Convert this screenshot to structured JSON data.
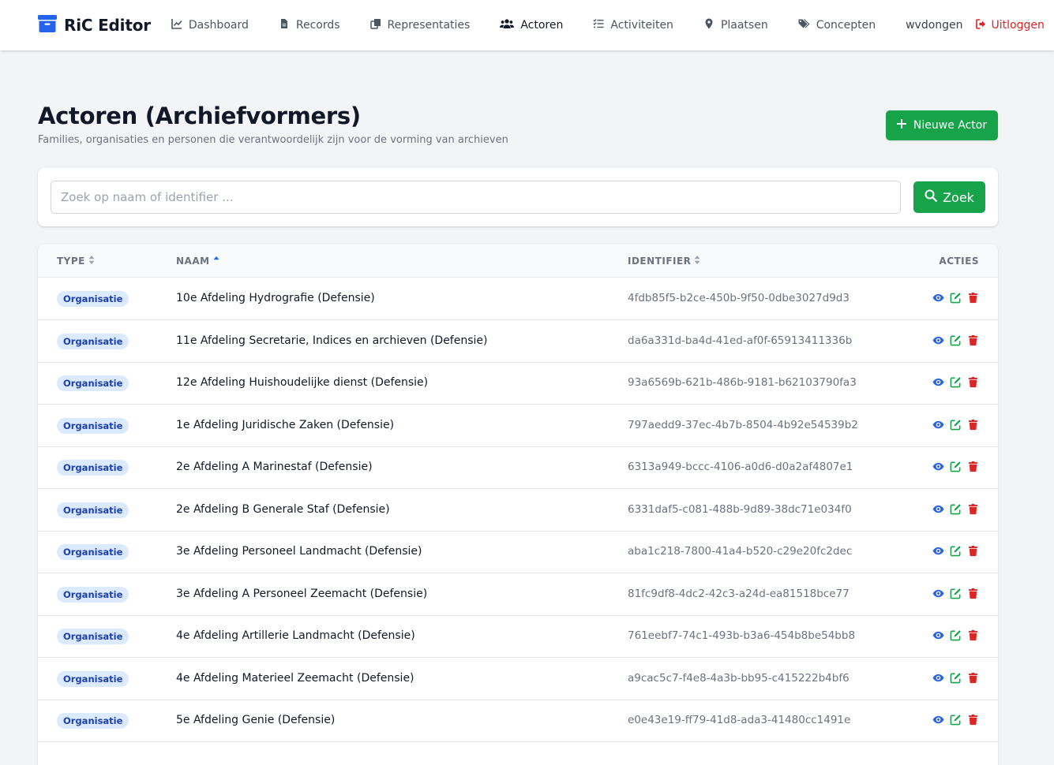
{
  "nav": {
    "brand": "RiC Editor",
    "items": [
      {
        "label": "Dashboard",
        "icon": "chart-line-icon",
        "active": false
      },
      {
        "label": "Records",
        "icon": "file-icon",
        "active": false
      },
      {
        "label": "Representaties",
        "icon": "copy-icon",
        "active": false
      },
      {
        "label": "Actoren",
        "icon": "users-icon",
        "active": true
      },
      {
        "label": "Activiteiten",
        "icon": "list-check-icon",
        "active": false
      },
      {
        "label": "Plaatsen",
        "icon": "map-marker-icon",
        "active": false
      },
      {
        "label": "Concepten",
        "icon": "tags-icon",
        "active": false
      }
    ],
    "user": "wvdongen",
    "logout": "Uitloggen"
  },
  "header": {
    "title": "Actoren (Archiefvormers)",
    "subtitle": "Families, organisaties en personen die verantwoordelijk zijn voor de vorming van archieven",
    "new_button": "Nieuwe Actor"
  },
  "search": {
    "placeholder": "Zoek op naam of identifier ...",
    "value": "",
    "button": "Zoek"
  },
  "table": {
    "columns": {
      "type": "TYPE",
      "naam": "NAAM",
      "identifier": "IDENTIFIER",
      "acties": "ACTIES"
    },
    "sort": {
      "column": "naam",
      "direction": "asc"
    },
    "rows": [
      {
        "type": "Organisatie",
        "naam": "10e Afdeling Hydrografie (Defensie)",
        "identifier": "4fdb85f5-b2ce-450b-9f50-0dbe3027d9d3"
      },
      {
        "type": "Organisatie",
        "naam": "11e Afdeling Secretarie, Indices en archieven (Defensie)",
        "identifier": "da6a331d-ba4d-41ed-af0f-65913411336b"
      },
      {
        "type": "Organisatie",
        "naam": "12e Afdeling Huishoudelijke dienst (Defensie)",
        "identifier": "93a6569b-621b-486b-9181-b62103790fa3"
      },
      {
        "type": "Organisatie",
        "naam": "1e Afdeling Juridische Zaken (Defensie)",
        "identifier": "797aedd9-37ec-4b7b-8504-4b92e54539b2"
      },
      {
        "type": "Organisatie",
        "naam": "2e Afdeling A Marinestaf (Defensie)",
        "identifier": "6313a949-bccc-4106-a0d6-d0a2af4807e1"
      },
      {
        "type": "Organisatie",
        "naam": "2e Afdeling B Generale Staf (Defensie)",
        "identifier": "6331daf5-c081-488b-9d89-38dc71e034f0"
      },
      {
        "type": "Organisatie",
        "naam": "3e Afdeling Personeel Landmacht (Defensie)",
        "identifier": "aba1c218-7800-41a4-b520-c29e20fc2dec"
      },
      {
        "type": "Organisatie",
        "naam": "3e Afdeling A Personeel Zeemacht (Defensie)",
        "identifier": "81fc9df8-4dc2-42c3-a24d-ea81518bce77"
      },
      {
        "type": "Organisatie",
        "naam": "4e Afdeling Artillerie Landmacht (Defensie)",
        "identifier": "761eebf7-74c1-493b-b3a6-454b8be54bb8"
      },
      {
        "type": "Organisatie",
        "naam": "4e Afdeling Materieel Zeemacht (Defensie)",
        "identifier": "a9cac5c7-f4e8-4a3b-bb95-c415222b4bf6"
      },
      {
        "type": "Organisatie",
        "naam": "5e Afdeling Genie (Defensie)",
        "identifier": "e0e43e19-ff79-41d8-ada3-41480cc1491e"
      }
    ]
  },
  "colors": {
    "primary_green": "#16a34a",
    "view_icon": "#2563eb",
    "edit_icon": "#16a34a",
    "delete_icon": "#dc2626",
    "logout": "#dc2626",
    "badge_bg": "#dbeafe",
    "badge_text": "#1e40af"
  }
}
